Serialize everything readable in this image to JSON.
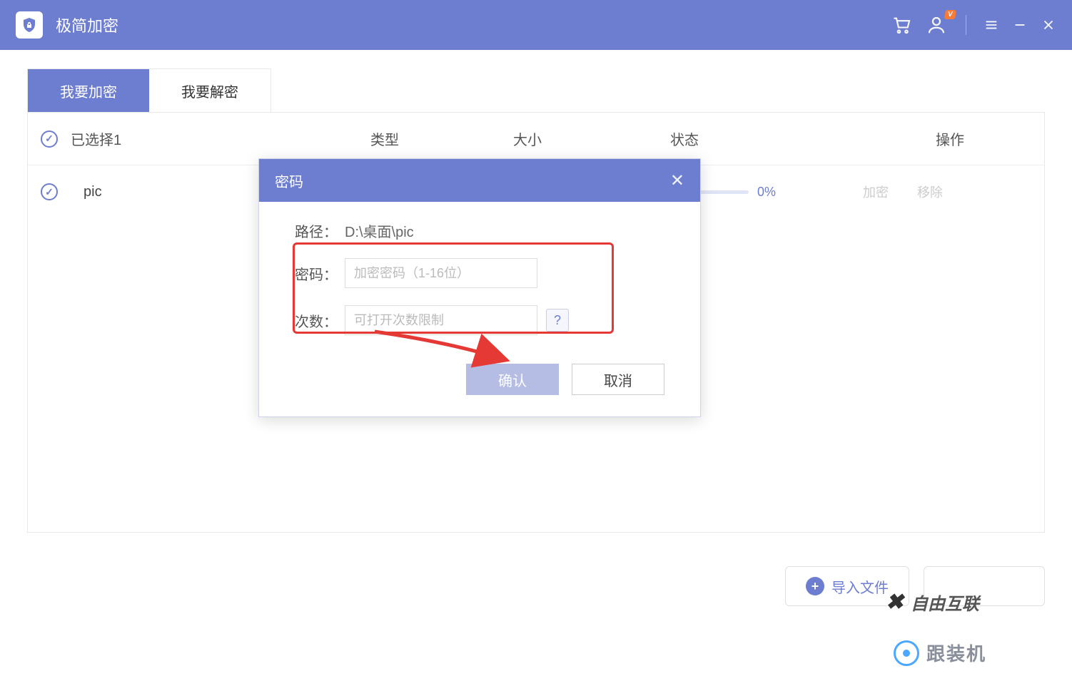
{
  "app": {
    "title": "极简加密"
  },
  "tabs": {
    "encrypt": "我要加密",
    "decrypt": "我要解密"
  },
  "table": {
    "selected_label": "已选择1",
    "headers": {
      "type": "类型",
      "size": "大小",
      "status": "状态",
      "operate": "操作"
    },
    "row": {
      "name": "pic",
      "progress_pct": "0%",
      "action_encrypt": "加密",
      "action_remove": "移除"
    }
  },
  "footer": {
    "import_label": "导入文件"
  },
  "modal": {
    "title": "密码",
    "path_label": "路径：",
    "path_value": "D:\\桌面\\pic",
    "password_label": "密码：",
    "password_placeholder": "加密密码（1-16位）",
    "times_label": "次数：",
    "times_placeholder": "可打开次数限制",
    "help": "?",
    "confirm": "确认",
    "cancel": "取消"
  },
  "watermark": {
    "text1": "自由互联",
    "text2": "跟装机"
  }
}
